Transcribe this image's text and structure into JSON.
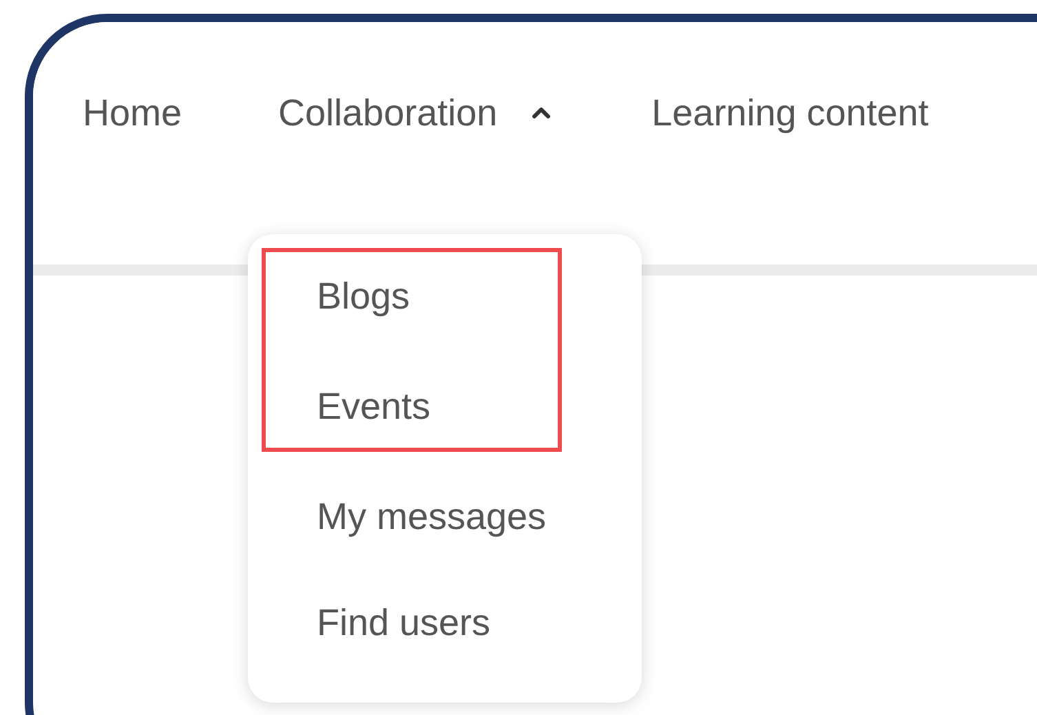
{
  "nav": [
    {
      "label": "Home",
      "kind": "link"
    },
    {
      "label": "Collaboration",
      "kind": "menu",
      "expanded": true
    },
    {
      "label": "Learning content",
      "kind": "link"
    }
  ],
  "menu": [
    {
      "label": "Blogs",
      "highlighted": true
    },
    {
      "label": "Events",
      "highlighted": true
    },
    {
      "label": "My messages",
      "highlighted": false
    },
    {
      "label": "Find users",
      "highlighted": false
    }
  ]
}
